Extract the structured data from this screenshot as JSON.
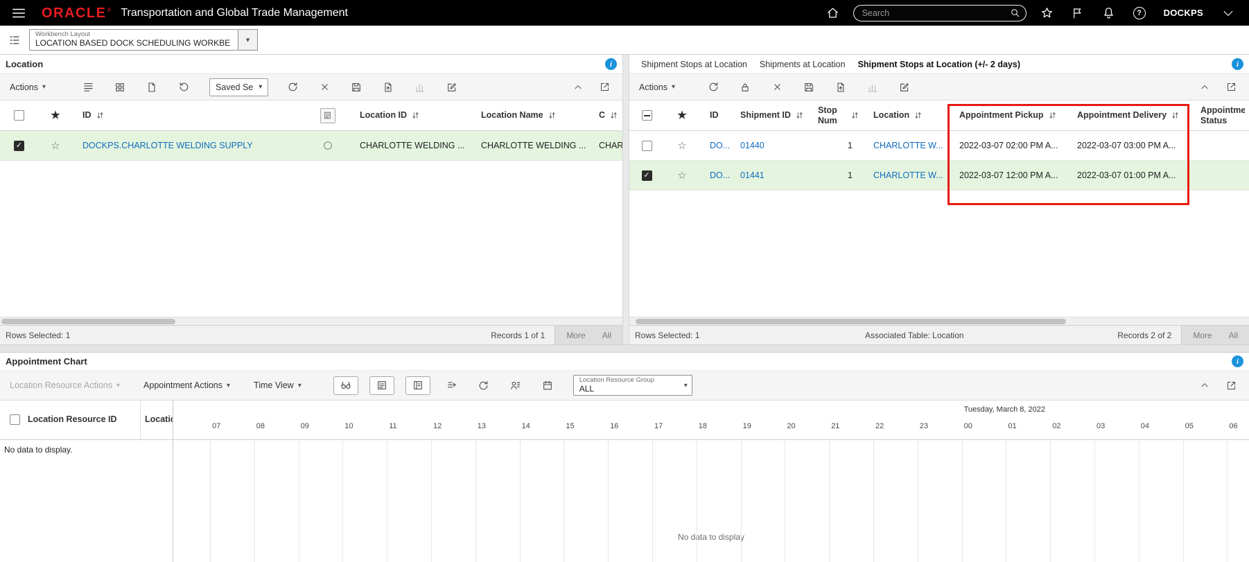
{
  "colors": {
    "brand_red": "#ea1b22",
    "link_blue": "#0f6cbf",
    "row_selected_green": "#e4f4de",
    "highlight_red": "#e8190f",
    "info_blue": "#1b92dc"
  },
  "icons": {
    "caret_down": "▾",
    "star_filled": "★",
    "star_outline": "☆",
    "check": "✓",
    "info_glyph": "i",
    "help_glyph": "?"
  },
  "topbar": {
    "brand": "ORACLE",
    "registered_mark": "®",
    "title": "Transportation and Global Trade Management",
    "search_placeholder": "Search",
    "user": "DOCKPS"
  },
  "layoutbar": {
    "label": "Workbench Layout",
    "value": "LOCATION BASED DOCK SCHEDULING WORKBE"
  },
  "location_panel": {
    "title": "Location",
    "toolbar": {
      "actions": "Actions",
      "saved_search": "Saved Se"
    },
    "columns": {
      "id": "ID",
      "location_id": "Location ID",
      "location_name": "Location Name",
      "city": "City"
    },
    "rows": [
      {
        "id": "DOCKPS.CHARLOTTE WELDING SUPPLY",
        "location_id": "CHARLOTTE WELDING ...",
        "location_name": "CHARLOTTE WELDING ...",
        "city": "CHARL"
      }
    ],
    "footer": {
      "rows_selected": "Rows Selected: 1",
      "records": "Records 1 of 1",
      "more": "More",
      "all": "All"
    }
  },
  "stops_panel": {
    "tabs": [
      {
        "label": "Shipment Stops at Location"
      },
      {
        "label": "Shipments at Location"
      },
      {
        "label": "Shipment Stops at Location (+/- 2 days)"
      }
    ],
    "toolbar": {
      "actions": "Actions"
    },
    "columns": {
      "id": "ID",
      "shipment_id": "Shipment ID",
      "stop_num": "Stop Num",
      "location": "Location",
      "appointment_pickup": "Appointment Pickup",
      "appointment_delivery": "Appointment Delivery",
      "appointment_status": "Appointment Status"
    },
    "rows": [
      {
        "id": "DO...",
        "shipment_id": "01440",
        "stop_num": "1",
        "location": "CHARLOTTE W...",
        "appointment_pickup": "2022-03-07 02:00 PM A...",
        "appointment_delivery": "2022-03-07 03:00 PM A..."
      },
      {
        "id": "DO...",
        "shipment_id": "01441",
        "stop_num": "1",
        "location": "CHARLOTTE W...",
        "appointment_pickup": "2022-03-07 12:00 PM A...",
        "appointment_delivery": "2022-03-07 01:00 PM A..."
      }
    ],
    "footer": {
      "rows_selected": "Rows Selected: 1",
      "associated": "Associated Table: Location",
      "records": "Records 2 of 2",
      "more": "More",
      "all": "All"
    }
  },
  "chart_panel": {
    "title": "Appointment Chart",
    "toolbar": {
      "location_resource_actions": "Location Resource Actions",
      "appointment_actions": "Appointment Actions",
      "time_view": "Time View",
      "group_label": "Location Resource Group",
      "group_value": "ALL"
    },
    "columns": {
      "resource_id": "Location Resource ID",
      "resource_extra": "Locatio"
    },
    "date_label": "Tuesday, March 8, 2022",
    "hours": [
      "07",
      "08",
      "09",
      "10",
      "11",
      "12",
      "13",
      "14",
      "15",
      "16",
      "17",
      "18",
      "19",
      "20",
      "21",
      "22",
      "23",
      "00",
      "01",
      "02",
      "03",
      "04",
      "05",
      "06"
    ],
    "no_data_left": "No data to display.",
    "no_data_center": "No data to display"
  }
}
